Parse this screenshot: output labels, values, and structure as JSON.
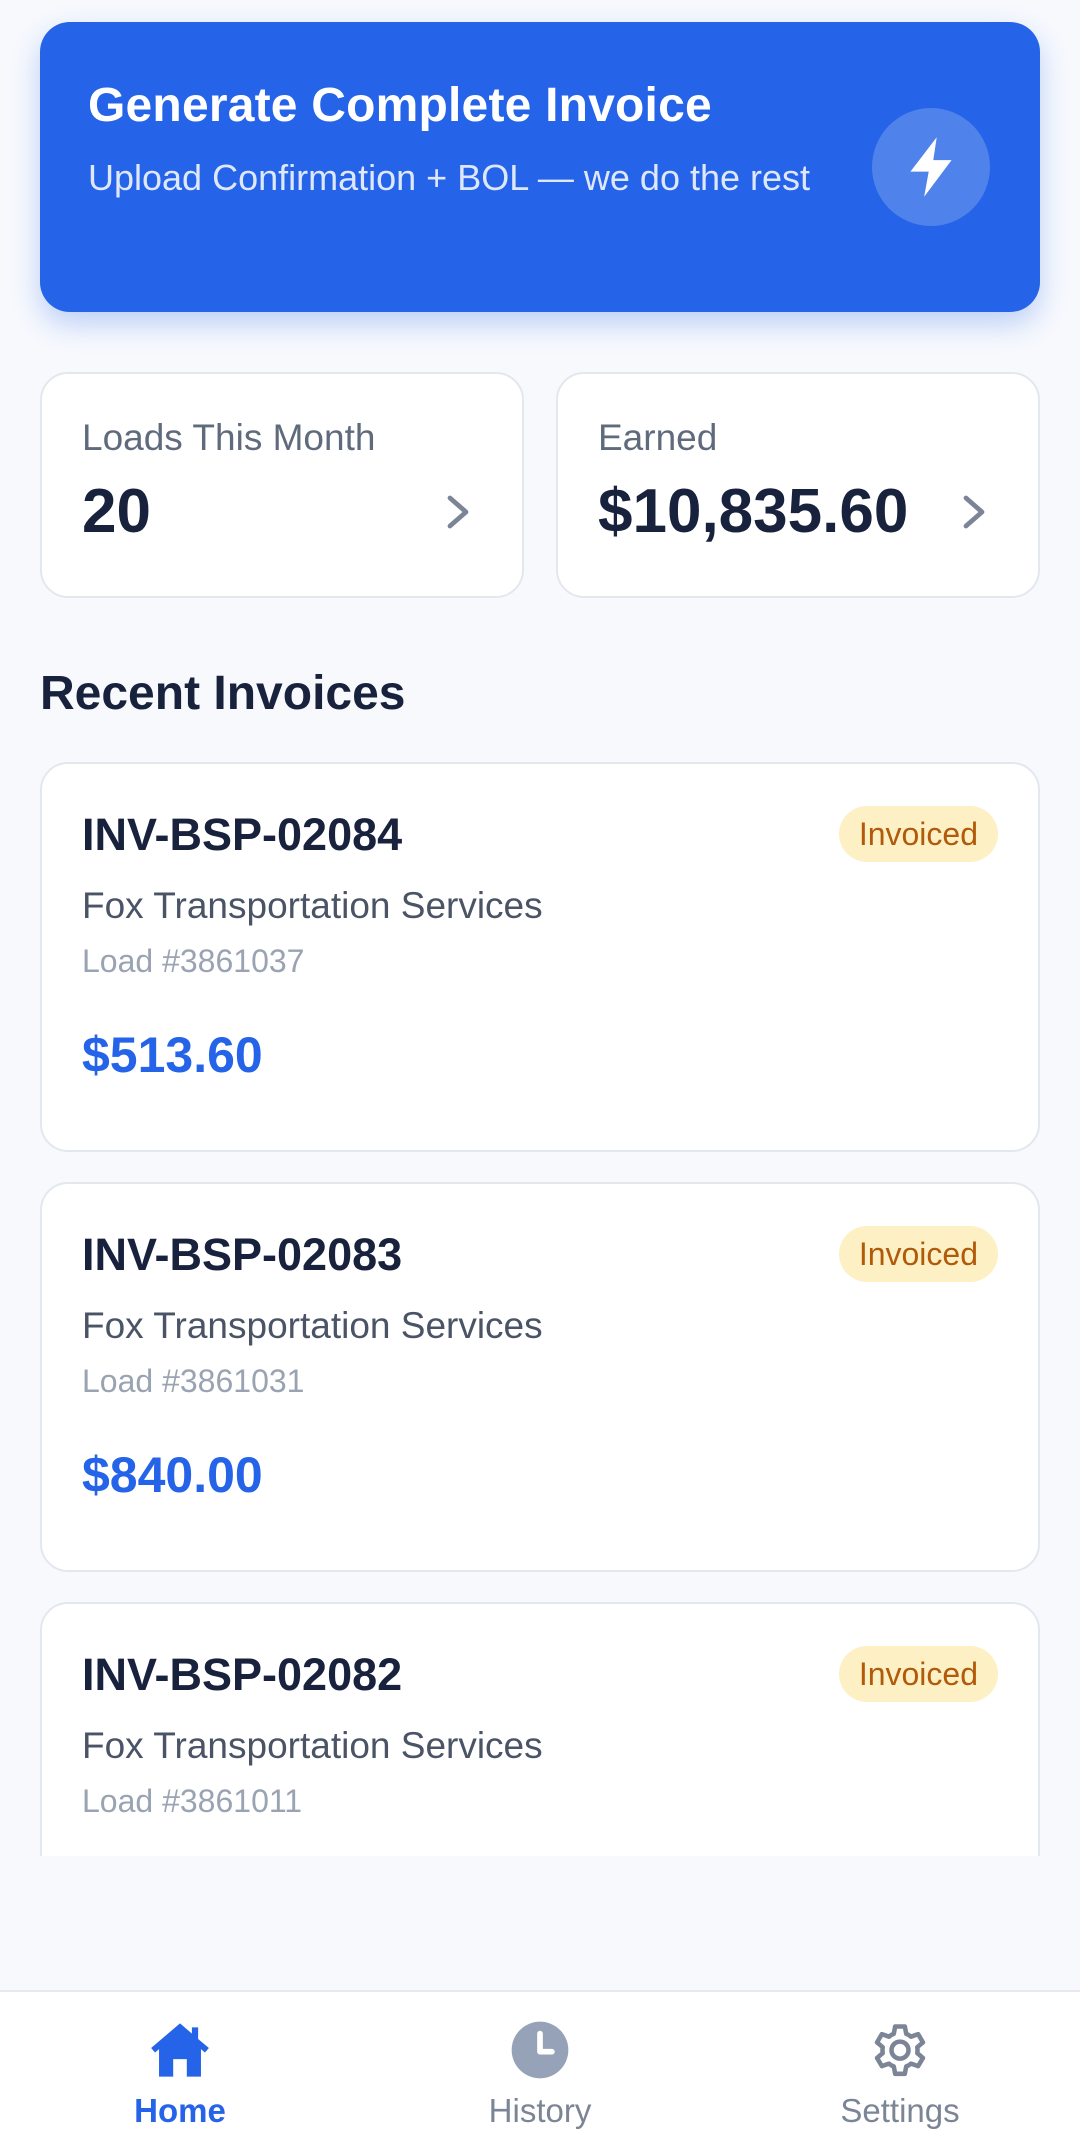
{
  "colors": {
    "primary": "#2563e8",
    "background": "#f7f9fd",
    "status_bg": "#fdf0c4",
    "status_text": "#b15a0a"
  },
  "hero": {
    "title": "Generate Complete Invoice",
    "subtitle": "Upload Confirmation + BOL — we do the rest",
    "icon": "lightning-bolt-icon"
  },
  "stats": {
    "loads": {
      "label": "Loads This Month",
      "value": "20"
    },
    "earned": {
      "label": "Earned",
      "value": "$10,835.60"
    }
  },
  "recent": {
    "title": "Recent Invoices",
    "invoices": [
      {
        "number": "INV-BSP-02084",
        "customer": "Fox Transportation Services",
        "load": "Load #3861037",
        "amount": "$513.60",
        "status": "Invoiced"
      },
      {
        "number": "INV-BSP-02083",
        "customer": "Fox Transportation Services",
        "load": "Load #3861031",
        "amount": "$840.00",
        "status": "Invoiced"
      },
      {
        "number": "INV-BSP-02082",
        "customer": "Fox Transportation Services",
        "load": "Load #3861011",
        "amount": "",
        "status": "Invoiced"
      }
    ]
  },
  "nav": {
    "home": "Home",
    "history": "History",
    "settings": "Settings"
  }
}
